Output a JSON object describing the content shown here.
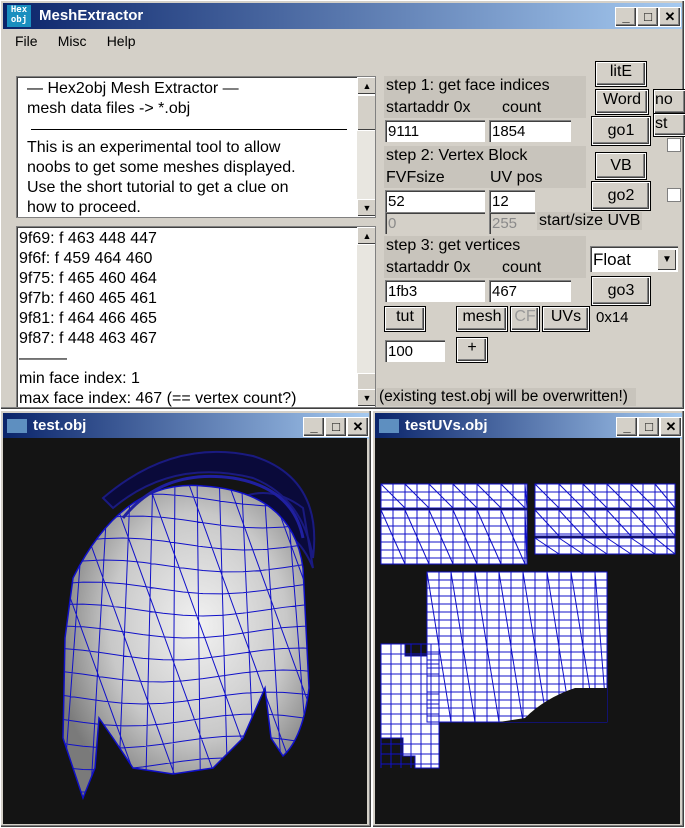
{
  "main_window": {
    "title": "MeshExtractor",
    "icon_text": "Hex obj",
    "menu": [
      "File",
      "Misc",
      "Help"
    ]
  },
  "info_box": {
    "lines": [
      " —   Hex2obj Mesh Extractor   —",
      "      mesh data files -> *.obj",
      "",
      "This is an experimental tool to allow",
      "noobs to get some meshes displayed.",
      "Use the short tutorial to get a clue on",
      "how to proceed."
    ]
  },
  "log_box": {
    "lines": [
      "9f69: f  463 448 447",
      "9f6f: f  459 464 460",
      "9f75: f  465 460 464",
      "9f7b: f  460 465 461",
      "9f81: f  464 466 465",
      "9f87: f  448 463 467",
      "———",
      "min face index: 1",
      "max face index: 467 (== vertex count?)"
    ]
  },
  "step1": {
    "title": "step 1: get face indices",
    "startaddr_label": "startaddr 0x",
    "count_label": "count",
    "startaddr": "9111",
    "count": "1854",
    "go_button": "go1"
  },
  "step2": {
    "title": "step 2: Vertex Block",
    "fvf_label": "FVFsize",
    "uvpos_label": "UV pos",
    "fvfsize": "52",
    "uvpos": "12",
    "uvb_start": "0",
    "uvb_size": "255",
    "uvb_label": "start/size UVB",
    "vb_button": "VB",
    "go_button": "go2"
  },
  "step3": {
    "title": "step 3: get vertices",
    "startaddr_label": "startaddr 0x",
    "count_label": "count",
    "startaddr": "1fb3",
    "count": "467",
    "format": "Float",
    "go_button": "go3"
  },
  "buttons": {
    "lite": "litE",
    "word": "Word",
    "no": "no",
    "st": "st",
    "tut": "tut",
    "mesh": "mesh",
    "cf": "CF",
    "uvs": "UVs",
    "ox14": "0x14",
    "plus": "+"
  },
  "percent_field": "100",
  "status_note": "(existing test.obj will be overwritten!)",
  "mesh_window": {
    "title": "test.obj"
  },
  "uv_window": {
    "title": "testUVs.obj"
  },
  "colors": {
    "wire": "#1010c8",
    "canvas": "#141414",
    "title_start": "#0a246a",
    "title_end": "#a6caf0"
  }
}
